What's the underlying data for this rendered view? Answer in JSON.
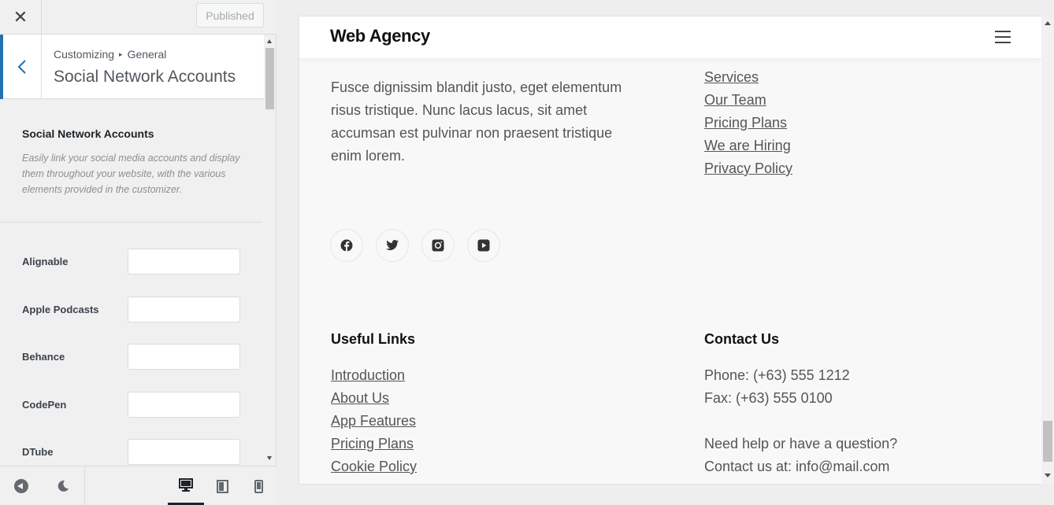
{
  "panel": {
    "close_icon": "close-icon",
    "publish_label": "Published",
    "breadcrumb": {
      "root": "Customizing",
      "section": "General"
    },
    "section_title": "Social Network Accounts",
    "description_title": "Social Network Accounts",
    "description": "Easily link your social media accounts and display them throughout your website, with the various elements provided in the customizer.",
    "fields": [
      {
        "label": "Alignable",
        "value": ""
      },
      {
        "label": "Apple Podcasts",
        "value": ""
      },
      {
        "label": "Behance",
        "value": ""
      },
      {
        "label": "CodePen",
        "value": ""
      },
      {
        "label": "DTube",
        "value": ""
      }
    ],
    "footer": {
      "icons": [
        "collapse-icon",
        "moon-icon",
        "desktop-icon",
        "tablet-icon",
        "mobile-icon"
      ],
      "active_device": "desktop"
    },
    "accent_color": "#2271b1"
  },
  "preview": {
    "site_title": "Web Agency",
    "about_text": "Fusce dignissim blandit justo, eget elementum risus tristique. Nunc lacus lacus, sit amet accumsan est pulvinar non praesent tristique enim lorem.",
    "quick_links": [
      "Services",
      "Our Team",
      "Pricing Plans",
      "We are Hiring",
      "Privacy Policy"
    ],
    "social_icons": [
      "facebook-icon",
      "twitter-icon",
      "instagram-icon",
      "youtube-icon"
    ],
    "useful_links_title": "Useful Links",
    "useful_links": [
      "Introduction",
      "About Us",
      "App Features",
      "Pricing Plans",
      "Cookie Policy"
    ],
    "contact_title": "Contact Us",
    "contact_lines": [
      "Phone: (+63) 555 1212",
      "Fax: (+63) 555 0100",
      "",
      "Need help or have a question?",
      "Contact us at: info@mail.com"
    ]
  }
}
